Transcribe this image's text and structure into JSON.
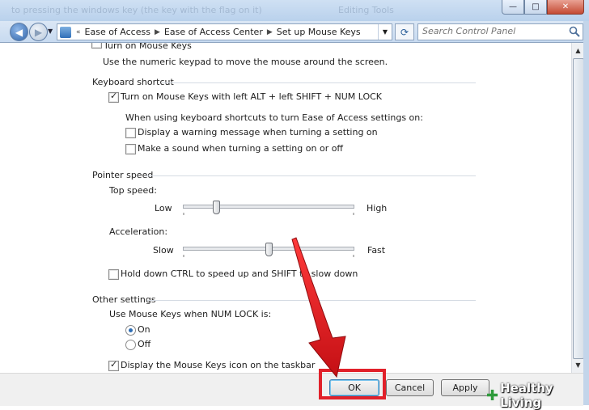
{
  "window": {
    "background_title_left": "to pressing the windows key (the key with the flag on it)",
    "background_title_right": "Editing Tools",
    "minimize_icon": "minimize-icon",
    "maximize_icon": "maximize-icon",
    "close_icon": "close-icon"
  },
  "navbar": {
    "breadcrumbs": [
      "Ease of Access",
      "Ease of Access Center",
      "Set up Mouse Keys"
    ],
    "search_placeholder": "Search Control Panel"
  },
  "content": {
    "mouse_keys_checkbox_label": "Turn on Mouse Keys",
    "mouse_keys_description": "Use the numeric keypad to move the mouse around the screen.",
    "keyboard_shortcut": {
      "title": "Keyboard shortcut",
      "turn_on_label": "Turn on Mouse Keys with left ALT + left SHIFT + NUM LOCK",
      "turn_on_checked": true,
      "intro": "When using keyboard shortcuts to turn Ease of Access settings on:",
      "warning_label": "Display a warning message when turning a setting on",
      "warning_checked": false,
      "sound_label": "Make a sound when turning a setting on or off",
      "sound_checked": false
    },
    "pointer_speed": {
      "title": "Pointer speed",
      "top_speed_label": "Top speed:",
      "top_speed_low": "Low",
      "top_speed_high": "High",
      "top_speed_value": 0.18,
      "acceleration_label": "Acceleration:",
      "acceleration_slow": "Slow",
      "acceleration_fast": "Fast",
      "acceleration_value": 0.5,
      "ctrl_shift_label": "Hold down CTRL to speed up and SHIFT to slow down",
      "ctrl_shift_checked": false
    },
    "other_settings": {
      "title": "Other settings",
      "num_lock_label": "Use Mouse Keys when NUM LOCK is:",
      "on_label": "On",
      "on_selected": true,
      "off_label": "Off",
      "off_selected": false,
      "taskbar_icon_label": "Display the Mouse Keys icon on the taskbar",
      "taskbar_icon_checked": true
    }
  },
  "footer": {
    "ok_label": "OK",
    "cancel_label": "Cancel",
    "apply_label": "Apply"
  },
  "annotation": {
    "highlight_color": "#e1212a",
    "arrow_color": "#e1212a"
  },
  "watermark": {
    "text": "Healthy Living"
  }
}
